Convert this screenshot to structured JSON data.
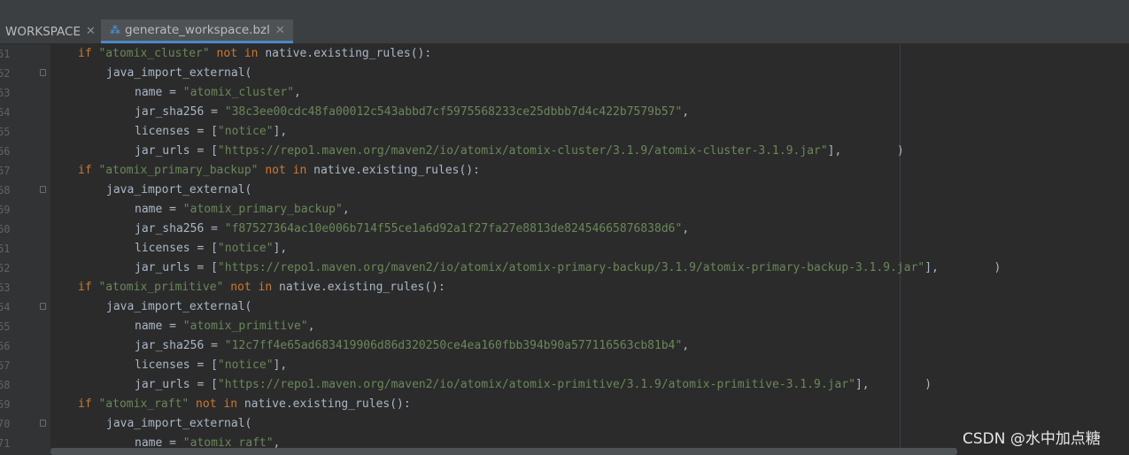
{
  "tabs": [
    {
      "label": "WORKSPACE"
    },
    {
      "label": "generate_workspace.bzl"
    }
  ],
  "lines": [
    {
      "num": "61",
      "indent": 0,
      "fold": false,
      "kw1": "if ",
      "s1": "\"atomix_cluster\"",
      "kw2": " not in",
      "t2": " native.existing_rules():",
      "s2": "",
      "t3": ""
    },
    {
      "num": "62",
      "indent": 1,
      "fold": true,
      "t1": "java_import_external(",
      "s1": "",
      "t2": "",
      "s2": "",
      "t3": ""
    },
    {
      "num": "63",
      "indent": 2,
      "fold": false,
      "t1": "name = ",
      "s1": "\"atomix_cluster\"",
      "t2": ",",
      "s2": "",
      "t3": ""
    },
    {
      "num": "64",
      "indent": 2,
      "fold": false,
      "t1": "jar_sha256 = ",
      "s1": "\"38c3ee00cdc48fa00012c543abbd7cf5975568233ce25dbbb7d4c422b7579b57\"",
      "t2": ",",
      "s2": "",
      "t3": ""
    },
    {
      "num": "65",
      "indent": 2,
      "fold": false,
      "t1": "licenses = [",
      "s1": "\"notice\"",
      "t2": "],",
      "s2": "",
      "t3": ""
    },
    {
      "num": "66",
      "indent": 2,
      "fold": false,
      "t1": "jar_urls = [",
      "s1": "\"https://repo1.maven.org/maven2/io/atomix/atomix-cluster/3.1.9/atomix-cluster-3.1.9.jar\"",
      "t2": "],",
      "s2": "",
      "t3": "        )"
    },
    {
      "num": "67",
      "indent": 0,
      "fold": false,
      "kw1": "if ",
      "s1": "\"atomix_primary_backup\"",
      "kw2": " not in",
      "t2": " native.existing_rules():",
      "s2": "",
      "t3": ""
    },
    {
      "num": "68",
      "indent": 1,
      "fold": true,
      "t1": "java_import_external(",
      "s1": "",
      "t2": "",
      "s2": "",
      "t3": ""
    },
    {
      "num": "69",
      "indent": 2,
      "fold": false,
      "t1": "name = ",
      "s1": "\"atomix_primary_backup\"",
      "t2": ",",
      "s2": "",
      "t3": ""
    },
    {
      "num": "60",
      "indent": 2,
      "fold": false,
      "t1": "jar_sha256 = ",
      "s1": "\"f87527364ac10e006b714f55ce1a6d92a1f27fa27e8813de82454665876838d6\"",
      "t2": ",",
      "s2": "",
      "t3": ""
    },
    {
      "num": "61",
      "indent": 2,
      "fold": false,
      "t1": "licenses = [",
      "s1": "\"notice\"",
      "t2": "],",
      "s2": "",
      "t3": ""
    },
    {
      "num": "62",
      "indent": 2,
      "fold": false,
      "t1": "jar_urls = [",
      "s1": "\"https://repo1.maven.org/maven2/io/atomix/atomix-primary-backup/3.1.9/atomix-primary-backup-3.1.9.jar\"",
      "t2": "],",
      "s2": "",
      "t3": "        )"
    },
    {
      "num": "63",
      "indent": 0,
      "fold": false,
      "kw1": "if ",
      "s1": "\"atomix_primitive\"",
      "kw2": " not in",
      "t2": " native.existing_rules():",
      "s2": "",
      "t3": ""
    },
    {
      "num": "64",
      "indent": 1,
      "fold": true,
      "t1": "java_import_external(",
      "s1": "",
      "t2": "",
      "s2": "",
      "t3": ""
    },
    {
      "num": "65",
      "indent": 2,
      "fold": false,
      "t1": "name = ",
      "s1": "\"atomix_primitive\"",
      "t2": ",",
      "s2": "",
      "t3": ""
    },
    {
      "num": "66",
      "indent": 2,
      "fold": false,
      "t1": "jar_sha256 = ",
      "s1": "\"12c7ff4e65ad683419906d86d320250ce4ea160fbb394b90a577116563cb81b4\"",
      "t2": ",",
      "s2": "",
      "t3": ""
    },
    {
      "num": "67",
      "indent": 2,
      "fold": false,
      "t1": "licenses = [",
      "s1": "\"notice\"",
      "t2": "],",
      "s2": "",
      "t3": ""
    },
    {
      "num": "68",
      "indent": 2,
      "fold": false,
      "t1": "jar_urls = [",
      "s1": "\"https://repo1.maven.org/maven2/io/atomix/atomix-primitive/3.1.9/atomix-primitive-3.1.9.jar\"",
      "t2": "],",
      "s2": "",
      "t3": "        )"
    },
    {
      "num": "69",
      "indent": 0,
      "fold": false,
      "kw1": "if ",
      "s1": "\"atomix_raft\"",
      "kw2": " not in",
      "t2": " native.existing_rules():",
      "s2": "",
      "t3": ""
    },
    {
      "num": "70",
      "indent": 1,
      "fold": true,
      "t1": "java_import_external(",
      "s1": "",
      "t2": "",
      "s2": "",
      "t3": ""
    },
    {
      "num": "71",
      "indent": 2,
      "fold": false,
      "t1": "name = ",
      "s1": "\"atomix_raft\"",
      "t2": ",",
      "s2": "",
      "t3": ""
    }
  ],
  "watermark": "CSDN @水中加点糖",
  "colors": {
    "keyword": "#cc7832",
    "string": "#6a8759",
    "text": "#a9b7c6",
    "background": "#2b2b2b",
    "active_tab_underline": "#4a88c7"
  }
}
